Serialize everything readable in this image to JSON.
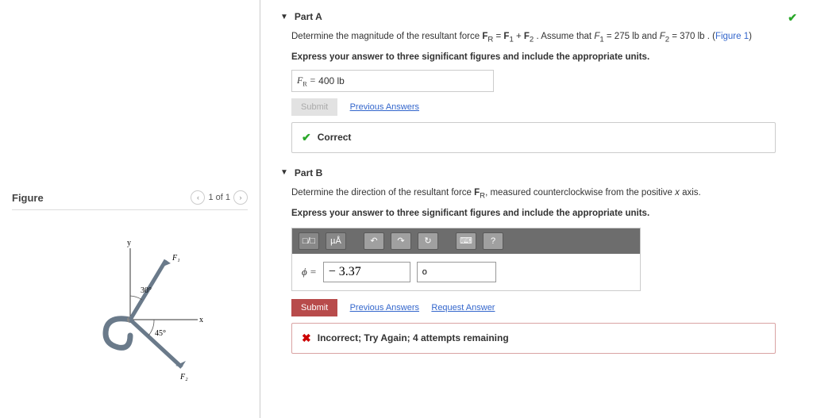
{
  "figure": {
    "label": "Figure",
    "pager": "1 of 1",
    "labels": {
      "x": "x",
      "y": "y",
      "F1": "F₁",
      "F2": "F₂",
      "ang1": "30°",
      "ang2": "45°"
    }
  },
  "partA": {
    "title": "Part A",
    "prompt_pre": "Determine the magnitude of the resultant force ",
    "eq": "F_R = F₁ + F₂",
    "assume": ". Assume that F₁ = 275 lb and F₂ = 370 lb . (",
    "figlink": "Figure 1",
    "close": ")",
    "instruction": "Express your answer to three significant figures and include the appropriate units.",
    "answer_symbol": "F_R = ",
    "answer_value": "400 lb",
    "submit": "Submit",
    "prev": "Previous Answers",
    "correct": "Correct"
  },
  "partB": {
    "title": "Part B",
    "prompt": "Determine the direction of the resultant force F_R, measured counterclockwise from the positive x axis.",
    "instruction": "Express your answer to three significant figures and include the appropriate units.",
    "phi": "ϕ = ",
    "value": "− 3.37",
    "unit": "o",
    "submit": "Submit",
    "prev": "Previous Answers",
    "req": "Request Answer",
    "wrong": "Incorrect; Try Again; 4 attempts remaining",
    "tb": {
      "frac": "□/□",
      "units": "µÅ",
      "undo": "↶",
      "redo": "↷",
      "reset": "↻",
      "kbd": "⌨",
      "help": "?"
    }
  }
}
